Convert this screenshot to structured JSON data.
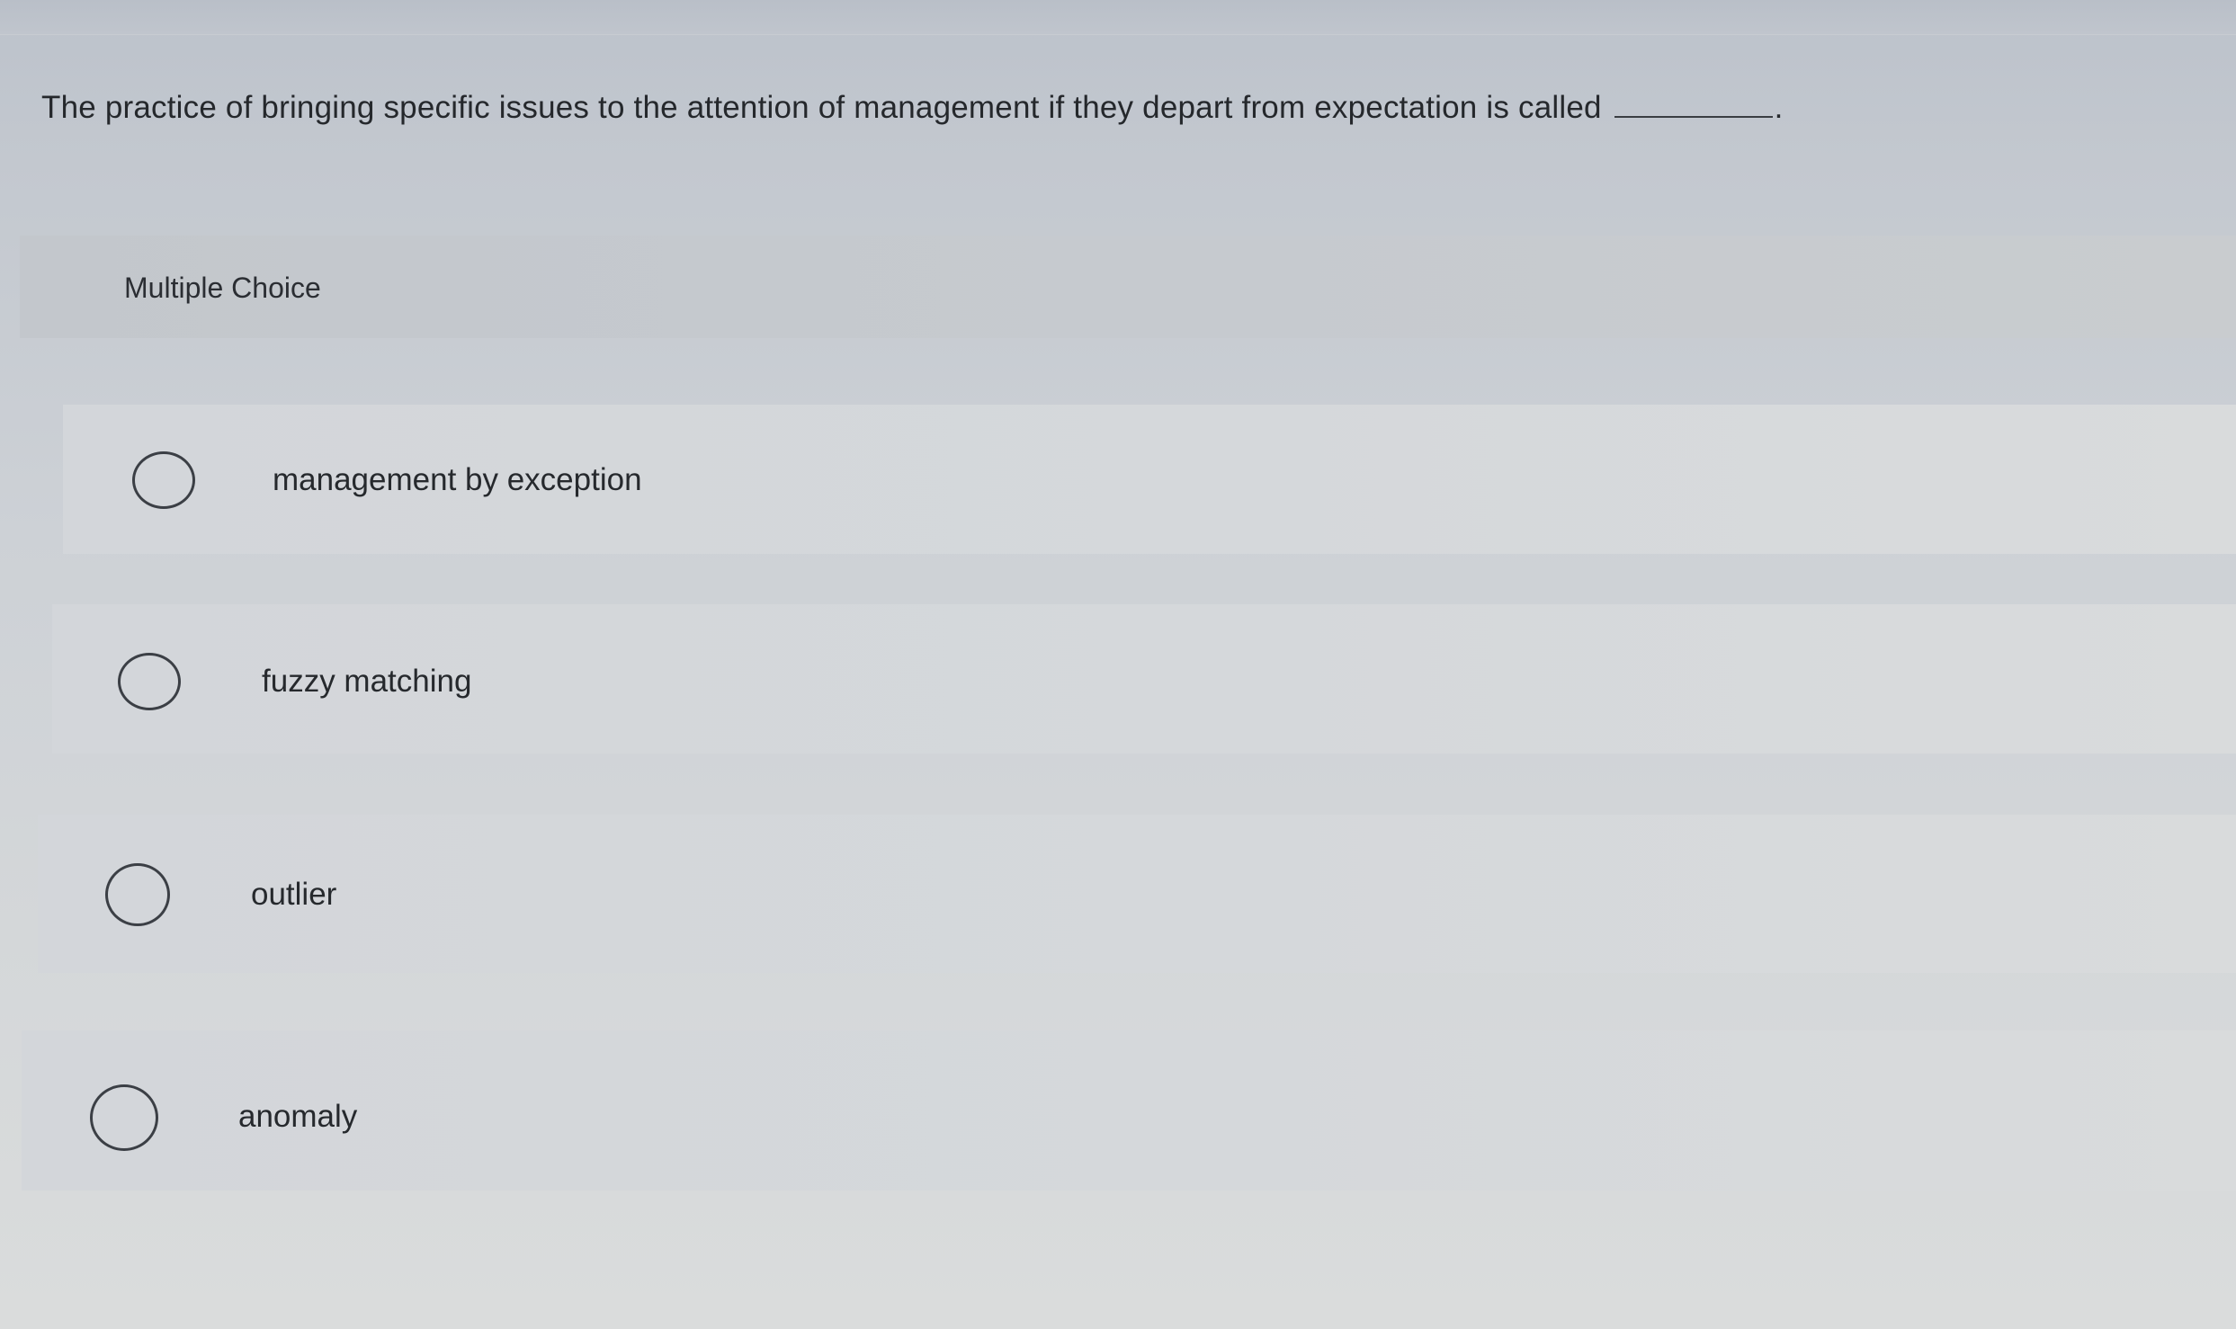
{
  "question": {
    "text": "The practice of bringing specific issues to the attention of management if they depart from expectation is called",
    "trailing_punctuation": "."
  },
  "section": {
    "label": "Multiple Choice"
  },
  "options": [
    {
      "label": "management by exception",
      "selected": false
    },
    {
      "label": "fuzzy matching",
      "selected": false
    },
    {
      "label": "outlier",
      "selected": false
    },
    {
      "label": "anomaly",
      "selected": false
    }
  ],
  "colors": {
    "background": "#cdd1d6",
    "header_band": "#c3c7cc",
    "option_band": "#d5d8db",
    "text": "#25282c",
    "radio_border": "#3b3f45"
  }
}
